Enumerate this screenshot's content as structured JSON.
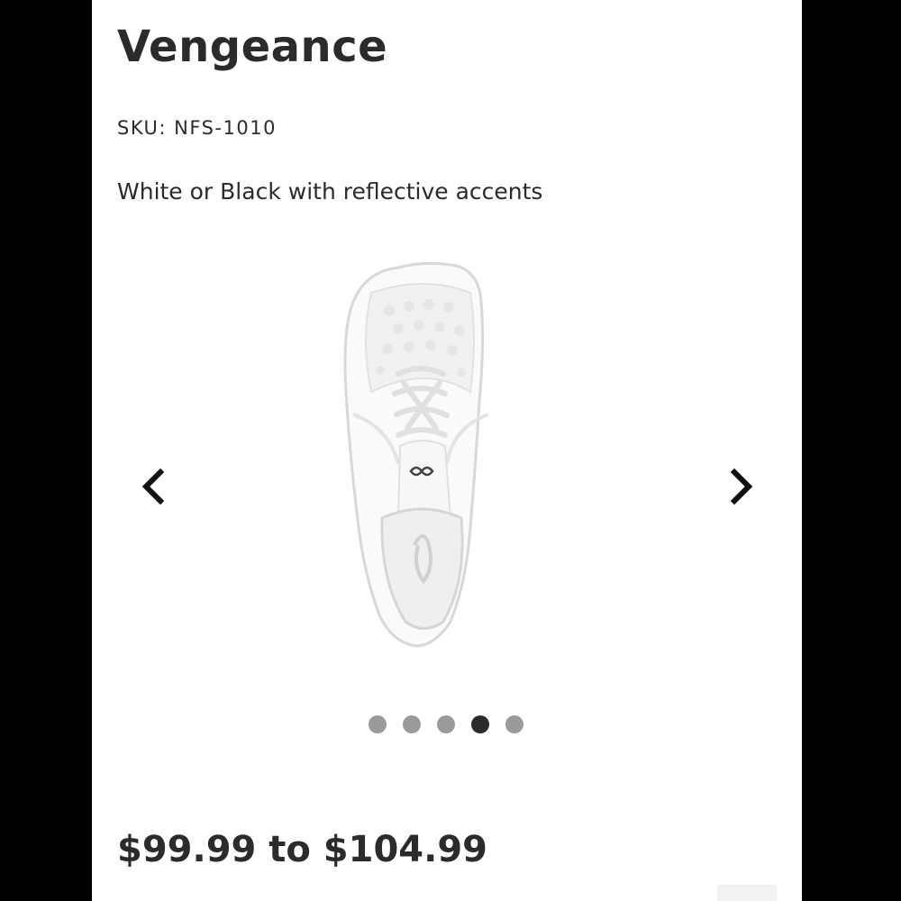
{
  "product": {
    "title": "Vengeance",
    "sku": "SKU: NFS-1010",
    "description": "White or Black with reflective accents",
    "price": "$99.99 to $104.99"
  },
  "carousel": {
    "slide_count": 5,
    "active_index": 3,
    "prev_icon": "chevron-left-icon",
    "next_icon": "chevron-right-icon",
    "image": "white-cheer-shoe-top-view"
  },
  "colors": {
    "text": "#2b2b2b",
    "dot_inactive": "#9a9a9a",
    "dot_active": "#2b2b2b",
    "background": "#ffffff"
  }
}
